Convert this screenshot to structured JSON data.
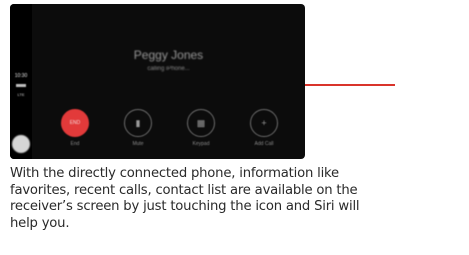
{
  "screen": {
    "sidebar": {
      "time": "10:30",
      "network": "LTE"
    },
    "call": {
      "caller_name": "Peggy Jones",
      "status": "calling iPhone..."
    },
    "controls": [
      {
        "label": "End",
        "icon": "end-call-icon",
        "glyph": "END"
      },
      {
        "label": "Mute",
        "icon": "microphone-icon",
        "glyph": "▮"
      },
      {
        "label": "Keypad",
        "icon": "keypad-icon",
        "glyph": "▦"
      },
      {
        "label": "Add Call",
        "icon": "add-call-icon",
        "glyph": "+"
      }
    ],
    "colors": {
      "end_call": "#e23a3a",
      "callout_line": "#d9342b"
    }
  },
  "caption": {
    "line1": "With the  directly connected phone, information like",
    "line2": "favorites, recent calls, contact list are available on the",
    "line3": "receiver’s screen by just touching the icon and Siri will",
    "line4": "help you."
  }
}
